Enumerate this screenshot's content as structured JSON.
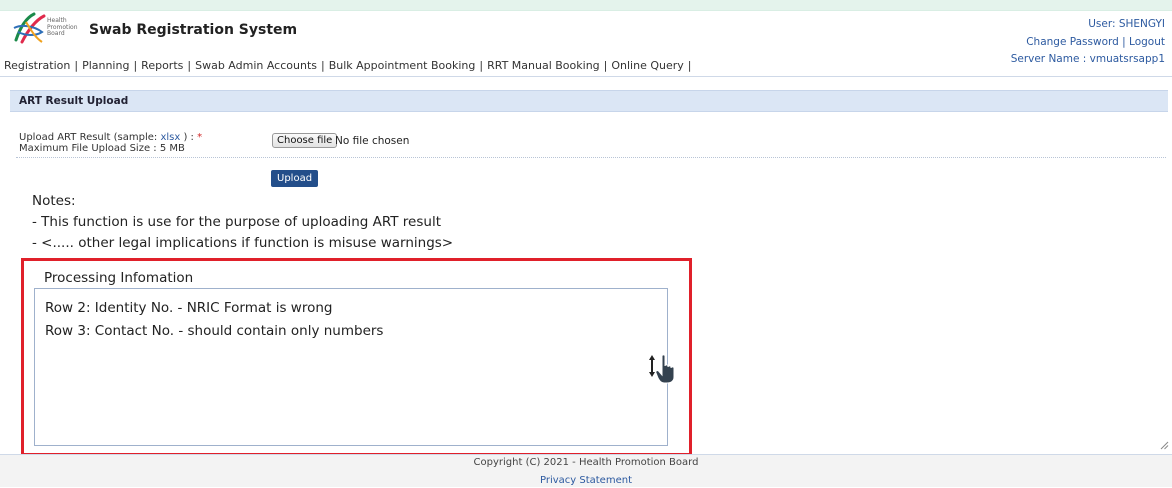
{
  "header": {
    "logo_text": [
      "Health",
      "Promotion",
      "Board"
    ],
    "title": "Swab Registration System",
    "user": "User: SHENGYI",
    "change_password": "Change Password",
    "logout": "Logout",
    "separator": "|",
    "server": "Server Name : vmuatsrsapp1"
  },
  "menu": {
    "items": [
      "Registration",
      "Planning",
      "Reports",
      "Swab Admin Accounts",
      "Bulk Appointment Booking",
      "RRT Manual Booking",
      "Online Query"
    ],
    "separator": "|"
  },
  "section": {
    "title": "ART Result Upload"
  },
  "upload": {
    "label_prefix": "Upload ART Result (sample: ",
    "sample_link": "xlsx",
    "label_suffix": " ) : ",
    "required_mark": "*",
    "max_size": "Maximum File Upload Size : 5 MB",
    "choose_button": "Choose file",
    "no_file": "No file chosen",
    "upload_button": "Upload"
  },
  "notes": {
    "title": "Notes:",
    "lines": [
      "- This function is use for the purpose of uploading ART result",
      "- <..... other legal implications if function is misuse warnings>"
    ]
  },
  "processing": {
    "title": "Processing Infomation",
    "lines": [
      "Row 2: Identity No. - NRIC Format is wrong",
      "Row 3: Contact No. - should contain only numbers"
    ]
  },
  "footer": {
    "copyright": "Copyright (C) 2021 - Health Promotion Board",
    "privacy": "Privacy Statement"
  },
  "colors": {
    "link": "#2d5aa0",
    "highlight_border": "#e0202a",
    "upload_button": "#234e8a",
    "section_header": "#dbe6f5"
  },
  "icons": [
    "hpb-logo-icon",
    "resize-updown-icon",
    "hand-pointer-icon",
    "textarea-resize-grip-icon"
  ]
}
